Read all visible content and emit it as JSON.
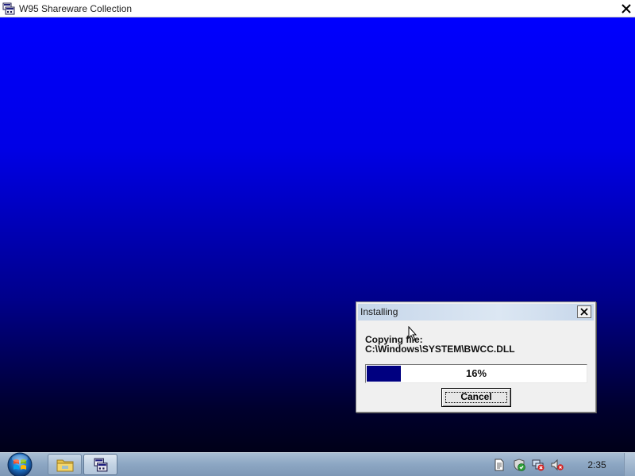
{
  "window": {
    "title": "W95 Shareware Collection",
    "icon": "installer-app-icon",
    "close_icon": "close-icon"
  },
  "desktop": {
    "background_top": "#0000fe",
    "background_bottom": "#000018"
  },
  "dialog": {
    "title": "Installing",
    "close_icon": "close-icon",
    "message_line1": "Copying file:",
    "message_line2": "C:\\Windows\\SYSTEM\\BWCC.DLL",
    "progress_fraction": 0.16,
    "progress_text": "16%",
    "progress_color": "#000080",
    "cancel_label": "Cancel"
  },
  "taskbar": {
    "start_icon": "windows-start-orb-icon",
    "buttons": [
      {
        "icon": "file-explorer-icon"
      },
      {
        "icon": "installer-app-icon",
        "active": true
      }
    ],
    "tray_icons": [
      "document-tray-icon",
      "security-shield-icon",
      "network-disconnected-icon",
      "volume-muted-icon"
    ],
    "clock": "2:35"
  }
}
